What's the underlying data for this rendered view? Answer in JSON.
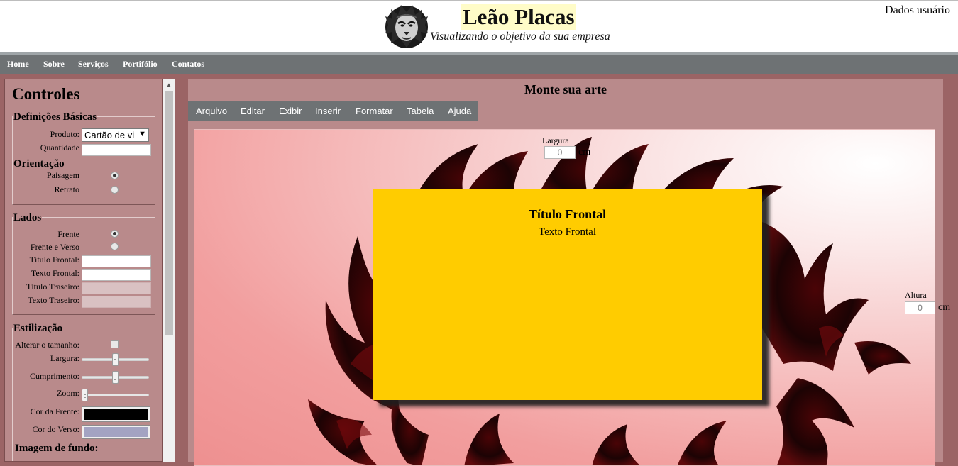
{
  "header": {
    "title": "Leão Placas",
    "subtitle": "Visualizando o objetivo da sua empresa",
    "user_link": "Dados usuário"
  },
  "nav": {
    "items": [
      "Home",
      "Sobre",
      "Serviços",
      "Portifólio",
      "Contatos"
    ]
  },
  "sidebar": {
    "title": "Controles",
    "basic": {
      "legend": "Definições Básicas",
      "product_label": "Produto:",
      "product_value": "Cartão de vi",
      "quantity_label": "Quantidade",
      "quantity_value": "",
      "orientation_title": "Orientação",
      "landscape_label": "Paisagem",
      "landscape_checked": true,
      "portrait_label": "Retrato",
      "portrait_checked": false
    },
    "sides": {
      "legend": "Lados",
      "front_label": "Frente",
      "front_checked": true,
      "front_back_label": "Frente e Verso",
      "front_back_checked": false,
      "front_title_label": "Título Frontal:",
      "front_text_label": "Texto Frontal:",
      "back_title_label": "Título Traseiro:",
      "back_text_label": "Texto Traseiro:"
    },
    "style": {
      "legend": "Estilização",
      "resize_label": "Alterar o tamanho:",
      "resize_checked": false,
      "width_label": "Largura:",
      "width_level": 0.5,
      "length_label": "Cumprimento:",
      "length_level": 0.5,
      "zoom_label": "Zoom:",
      "zoom_level": 0.0,
      "front_color_label": "Cor da Frente:",
      "front_color": "#000000",
      "back_color_label": "Cor do Verso:",
      "back_color": "#a3a3c2"
    },
    "background_image_label": "Imagem de fundo:"
  },
  "main": {
    "title": "Monte sua arte",
    "menu": [
      "Arquivo",
      "Editar",
      "Exibir",
      "Inserir",
      "Formatar",
      "Tabela",
      "Ajuda"
    ],
    "width_label": "Largura",
    "width_value": "0",
    "height_label": "Altura",
    "height_value": "0",
    "unit": "cm",
    "card": {
      "title": "Título Frontal",
      "text": "Texto Frontal",
      "color": "#ffcc00"
    }
  },
  "colors": {
    "page_bg": "#9b6465",
    "panel_bg": "#b98a8b",
    "nav_bg": "#6e7274"
  }
}
